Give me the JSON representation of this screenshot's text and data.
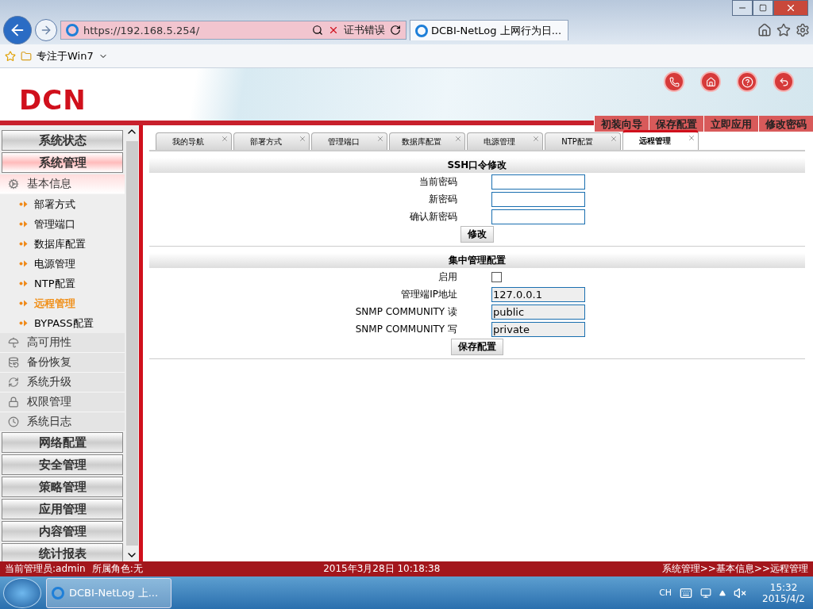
{
  "browser": {
    "address": "https://192.168.5.254/",
    "cert_error": "证书错误",
    "tab_title": "DCBI-NetLog 上网行为日...",
    "favorite": "专注于Win7"
  },
  "header": {
    "logo": "DCN",
    "actions": [
      "初装向导",
      "保存配置",
      "立即应用",
      "修改密码"
    ]
  },
  "sidebar": {
    "items": [
      {
        "kind": "section",
        "label": "系统状态",
        "selected": false
      },
      {
        "kind": "section",
        "label": "系统管理",
        "selected": true
      },
      {
        "kind": "group",
        "label": "基本信息",
        "expanded": true,
        "children": [
          {
            "label": "部署方式",
            "selected": false
          },
          {
            "label": "管理端口",
            "selected": false
          },
          {
            "label": "数据库配置",
            "selected": false
          },
          {
            "label": "电源管理",
            "selected": false
          },
          {
            "label": "NTP配置",
            "selected": false
          },
          {
            "label": "远程管理",
            "selected": true
          },
          {
            "label": "BYPASS配置",
            "selected": false
          }
        ]
      },
      {
        "kind": "group",
        "label": "高可用性",
        "expanded": false
      },
      {
        "kind": "group",
        "label": "备份恢复",
        "expanded": false
      },
      {
        "kind": "group",
        "label": "系统升级",
        "expanded": false
      },
      {
        "kind": "group",
        "label": "权限管理",
        "expanded": false
      },
      {
        "kind": "group",
        "label": "系统日志",
        "expanded": false
      },
      {
        "kind": "section",
        "label": "网络配置",
        "selected": false
      },
      {
        "kind": "section",
        "label": "安全管理",
        "selected": false
      },
      {
        "kind": "section",
        "label": "策略管理",
        "selected": false
      },
      {
        "kind": "section",
        "label": "应用管理",
        "selected": false
      },
      {
        "kind": "section",
        "label": "内容管理",
        "selected": false
      },
      {
        "kind": "section",
        "label": "统计报表",
        "selected": false
      }
    ]
  },
  "tabs": [
    {
      "label": "我的导航",
      "selected": false
    },
    {
      "label": "部署方式",
      "selected": false
    },
    {
      "label": "管理端口",
      "selected": false
    },
    {
      "label": "数据库配置",
      "selected": false
    },
    {
      "label": "电源管理",
      "selected": false
    },
    {
      "label": "NTP配置",
      "selected": false
    },
    {
      "label": "远程管理",
      "selected": true
    }
  ],
  "sections": [
    {
      "title": "SSH口令修改",
      "fields": [
        {
          "kind": "password",
          "label": "当前密码"
        },
        {
          "kind": "password",
          "label": "新密码"
        },
        {
          "kind": "password",
          "label": "确认新密码"
        }
      ],
      "button": "修改"
    },
    {
      "title": "集中管理配置",
      "fields": [
        {
          "kind": "checkbox",
          "label": "启用",
          "checked": false
        },
        {
          "kind": "text",
          "label": "管理端IP地址",
          "value": "127.0.0.1",
          "disabled": true
        },
        {
          "kind": "text",
          "label": "SNMP COMMUNITY 读",
          "value": "public",
          "disabled": true
        },
        {
          "kind": "text",
          "label": "SNMP COMMUNITY 写",
          "value": "private",
          "disabled": true
        }
      ],
      "button": "保存配置"
    }
  ],
  "status_bar": {
    "admin": "当前管理员:admin",
    "role": "所属角色:无",
    "datetime": "2015年3月28日 10:18:38",
    "breadcrumb": "系统管理>>基本信息>>远程管理"
  },
  "taskbar": {
    "app": "DCBI-NetLog 上...",
    "language": "CH",
    "time": "15:32",
    "date": "2015/4/2"
  }
}
